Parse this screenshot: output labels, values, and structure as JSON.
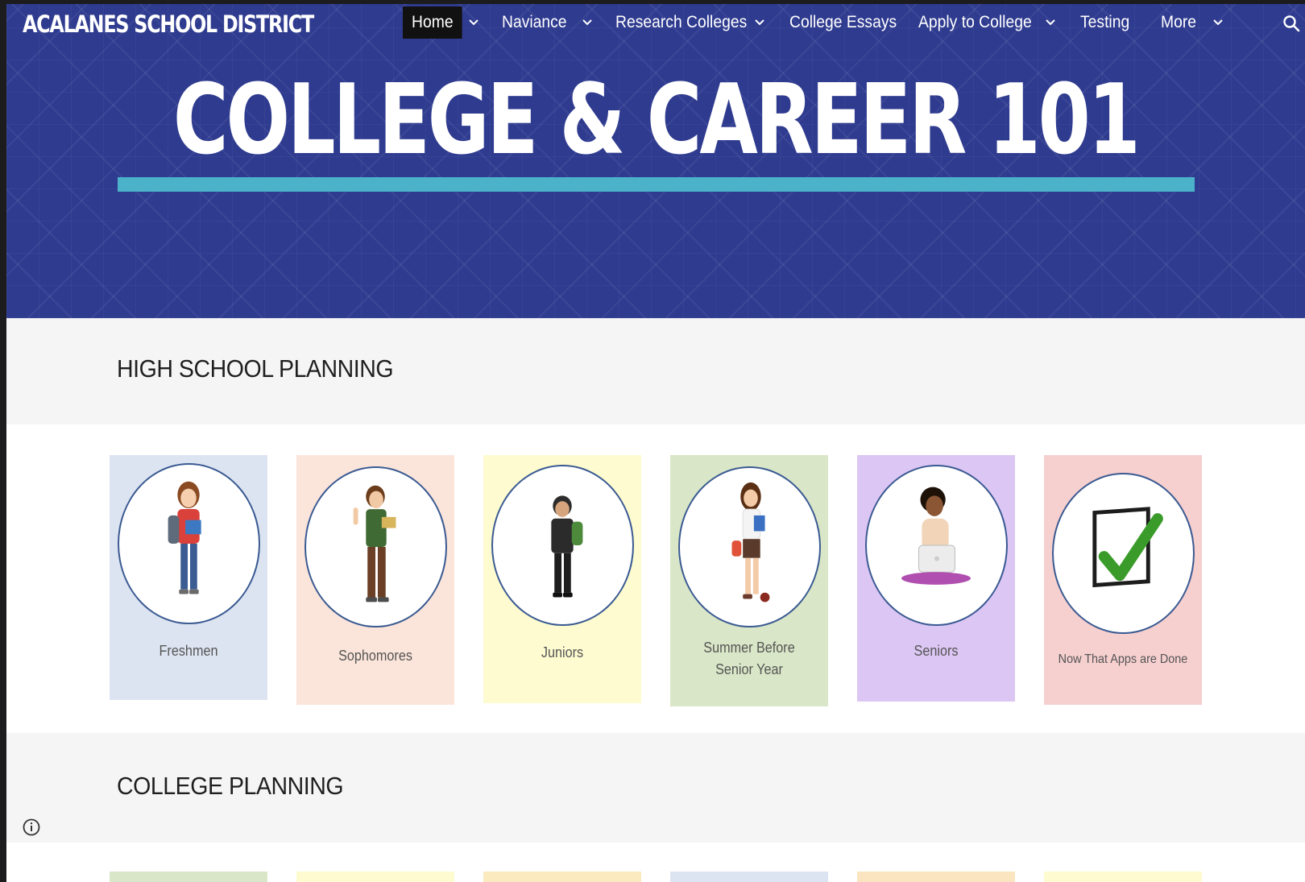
{
  "site": {
    "title": "ACALANES SCHOOL DISTRICT"
  },
  "nav": {
    "items": [
      {
        "label": "Home",
        "active": true,
        "has_dropdown": true
      },
      {
        "label": "Naviance",
        "has_dropdown": true
      },
      {
        "label": "Research Colleges",
        "has_dropdown": true
      },
      {
        "label": "College Essays",
        "has_dropdown": false
      },
      {
        "label": "Apply to College",
        "has_dropdown": true
      },
      {
        "label": "Testing",
        "has_dropdown": false
      },
      {
        "label": "More",
        "has_dropdown": true
      }
    ],
    "search_icon": "search-icon"
  },
  "hero": {
    "title": "COLLEGE & CAREER 101"
  },
  "sections": {
    "high_school": {
      "heading": "HIGH SCHOOL PLANNING",
      "cards": [
        {
          "label": "Freshmen",
          "bg": "#dde4f1",
          "icon": "student-girl-backpack-icon"
        },
        {
          "label": "Sophomores",
          "bg": "#fbe5da",
          "icon": "student-boy-reading-icon"
        },
        {
          "label": "Juniors",
          "bg": "#fdfbcf",
          "icon": "student-boy-backpack-icon"
        },
        {
          "label_lines": [
            "Summer Before",
            "Senior Year"
          ],
          "bg": "#d9e6c7",
          "icon": "student-girl-books-icon"
        },
        {
          "label": "Seniors",
          "bg": "#dcc6f4",
          "icon": "student-laptop-icon"
        },
        {
          "label": "Now That Apps are Done",
          "bg": "#f6cfcf",
          "icon": "checkmark-box-icon"
        }
      ]
    },
    "college": {
      "heading": "COLLEGE PLANNING",
      "card_colors": [
        "#d9e6c7",
        "#fdfbcf",
        "#fbe9c0",
        "#dde4f1",
        "#fbe5c0",
        "#fdfbcf"
      ]
    }
  },
  "footer": {
    "info_icon": "info-icon"
  },
  "colors": {
    "hero_bg": "#2f3b8f",
    "hero_rule": "#4bb2c9",
    "nav_active_bg": "#111111",
    "circle_border": "#3a5a92"
  }
}
